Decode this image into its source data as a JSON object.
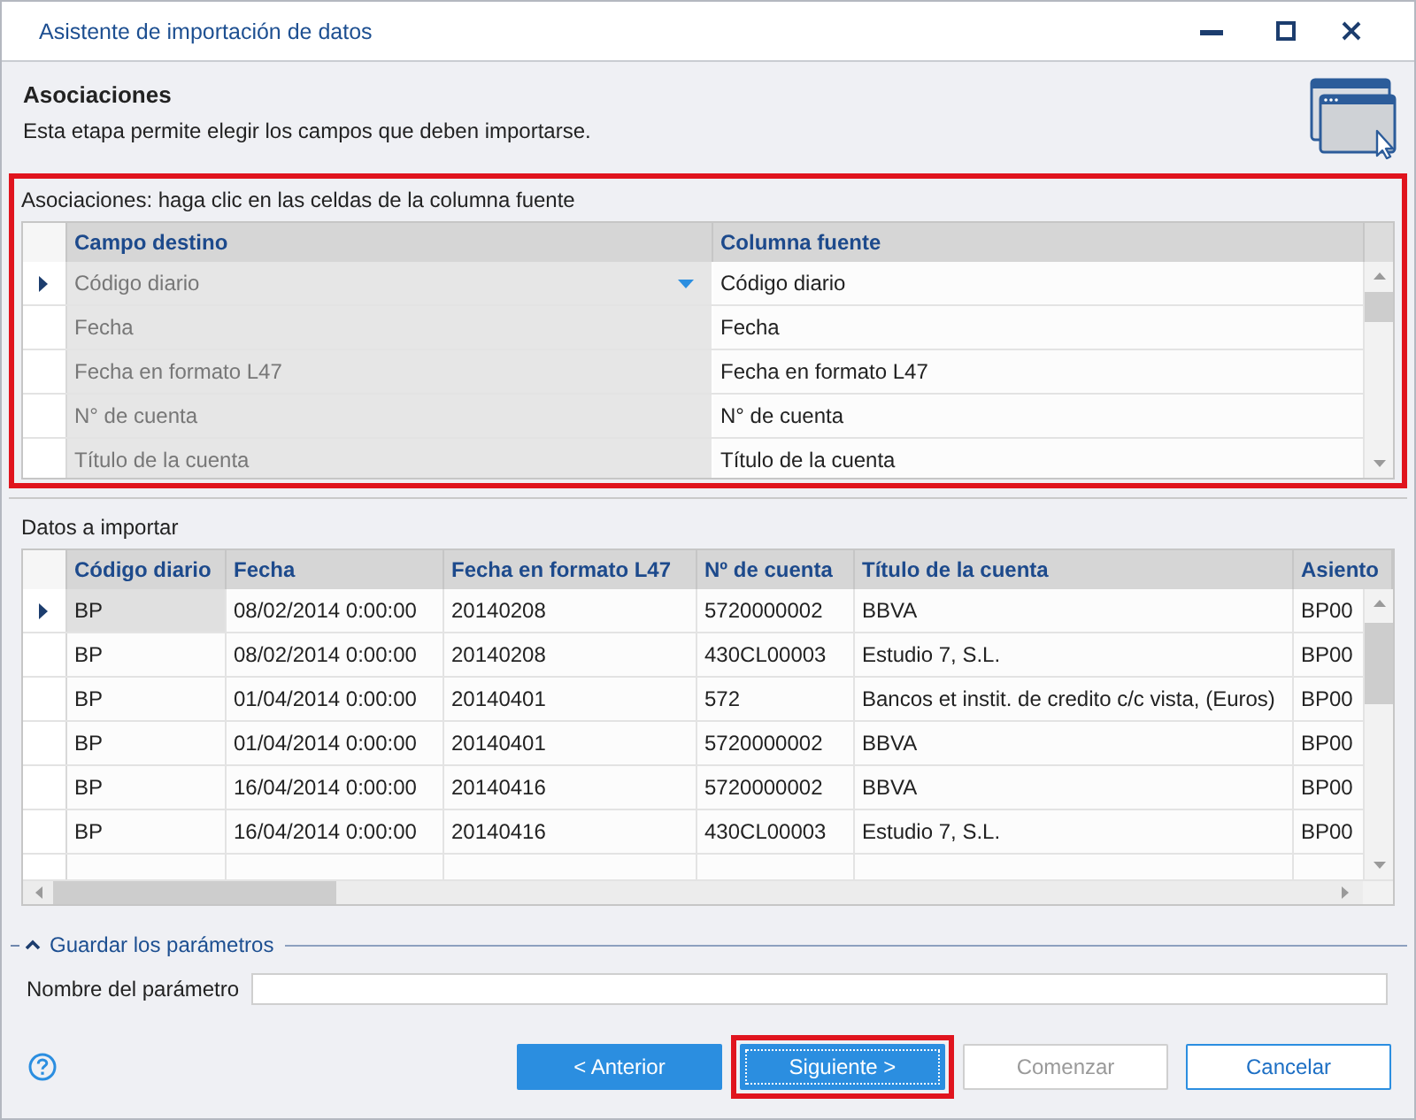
{
  "window": {
    "title": "Asistente de importación de datos"
  },
  "step": {
    "title": "Asociaciones",
    "description": "Esta etapa permite elegir los campos que deben importarse."
  },
  "associations": {
    "highlighted": true,
    "label": "Asociaciones: haga clic en las celdas de la columna fuente",
    "columns": [
      "Campo destino",
      "Columna fuente"
    ],
    "rows": [
      {
        "selected": true,
        "target": "Código diario",
        "source": "Código diario"
      },
      {
        "selected": false,
        "target": "Fecha",
        "source": "Fecha"
      },
      {
        "selected": false,
        "target": "Fecha en formato L47",
        "source": "Fecha en formato L47"
      },
      {
        "selected": false,
        "target": "N° de cuenta",
        "source": "N° de cuenta"
      },
      {
        "selected": false,
        "target": "Título de la cuenta",
        "source": "Título de la cuenta"
      }
    ]
  },
  "import_data": {
    "label": "Datos a importar",
    "columns": [
      "Código diario",
      "Fecha",
      "Fecha en formato L47",
      "Nº de cuenta",
      "Título de la cuenta",
      "Asiento"
    ],
    "rows": [
      {
        "selected": true,
        "cells": [
          "BP",
          "08/02/2014 0:00:00",
          "20140208",
          "5720000002",
          "BBVA",
          "BP00"
        ]
      },
      {
        "selected": false,
        "cells": [
          "BP",
          "08/02/2014 0:00:00",
          "20140208",
          "430CL00003",
          "Estudio 7, S.L.",
          "BP00"
        ]
      },
      {
        "selected": false,
        "cells": [
          "BP",
          "01/04/2014 0:00:00",
          "20140401",
          "572",
          "Bancos et instit. de credito c/c vista, (Euros)",
          "BP00"
        ]
      },
      {
        "selected": false,
        "cells": [
          "BP",
          "01/04/2014 0:00:00",
          "20140401",
          "5720000002",
          "BBVA",
          "BP00"
        ]
      },
      {
        "selected": false,
        "cells": [
          "BP",
          "16/04/2014 0:00:00",
          "20140416",
          "5720000002",
          "BBVA",
          "BP00"
        ]
      },
      {
        "selected": false,
        "cells": [
          "BP",
          "16/04/2014 0:00:00",
          "20140416",
          "430CL00003",
          "Estudio 7, S.L.",
          "BP00"
        ]
      }
    ]
  },
  "save_parameters": {
    "title": "Guardar los parámetros",
    "expanded": true,
    "field_label": "Nombre del parámetro"
  },
  "buttons": [
    {
      "label": "< Anterior",
      "kind": "primary",
      "disabled": false,
      "focused": false,
      "highlighted": false
    },
    {
      "label": "Siguiente >",
      "kind": "primary",
      "disabled": false,
      "focused": true,
      "highlighted": true
    },
    {
      "label": "Comenzar",
      "kind": "outline",
      "disabled": true,
      "focused": false,
      "highlighted": false
    },
    {
      "label": "Cancelar",
      "kind": "outline",
      "disabled": false,
      "focused": false,
      "highlighted": false
    }
  ]
}
